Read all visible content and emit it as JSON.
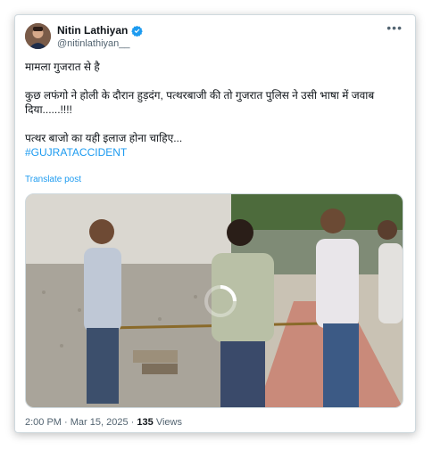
{
  "post": {
    "author_name": "Nitin Lathiyan",
    "author_handle": "@nitinlathiyan__",
    "lines": [
      "मामला गुजरात से है",
      "कुछ लफंगो ने होली के दौरान हुड़दंग, पत्थरबाजी की तो गुजरात पुलिस ने उसी भाषा में जवाब दिया......!!!!",
      "पत्थर बाजो का यही इलाज होना चाहिए..."
    ],
    "hashtag": "#GUJRATACCIDENT",
    "translate_label": "Translate post",
    "time": "2:00 PM",
    "date": "Mar 15, 2025",
    "separator": "·",
    "views_count": "135",
    "views_label": "Views"
  },
  "icons": {
    "verified": "verified-badge-icon",
    "more": "more-options-icon",
    "loading": "loading-spinner-icon"
  },
  "colors": {
    "accent": "#1d9bf0",
    "text": "#0f1419",
    "muted": "#536471"
  }
}
